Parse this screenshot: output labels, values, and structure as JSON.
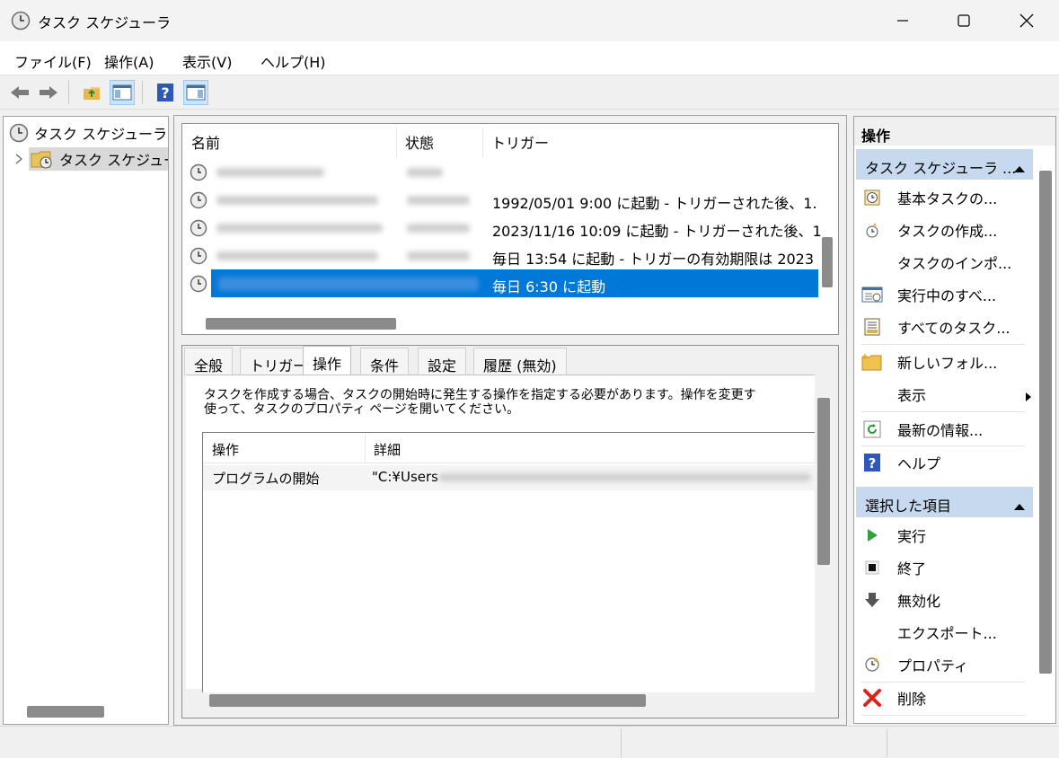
{
  "window": {
    "title": "タスク スケジューラ",
    "icon": "clock-icon",
    "controls": [
      "minimize-icon",
      "maximize-icon",
      "close-icon"
    ]
  },
  "menu": [
    "ファイル(F)",
    "操作(A)",
    "表示(V)",
    "ヘルプ(H)"
  ],
  "toolbar": [
    "back-arrow-icon",
    "forward-arrow-icon",
    "up-folder-icon",
    "show-hide-console-tree-icon",
    "help-icon",
    "show-hide-action-pane-icon"
  ],
  "tree": {
    "root": "タスク スケジューラ (",
    "child": "タスク スケジュー"
  },
  "taskList": {
    "columns": [
      "名前",
      "状態",
      "トリガー"
    ],
    "rows": [
      {
        "trigger": ""
      },
      {
        "trigger": "1992/05/01 9:00 に起動 - トリガーされた後、1."
      },
      {
        "trigger": "2023/11/16 10:09 に起動 - トリガーされた後、1"
      },
      {
        "trigger": "毎日 13:54 に起動 - トリガーの有効期限は 2023"
      },
      {
        "trigger": "毎日 6:30 に起動"
      }
    ]
  },
  "detail": {
    "tabs": [
      "全般",
      "トリガー",
      "操作",
      "条件",
      "設定",
      "履歴 (無効)"
    ],
    "activeTab": 2,
    "description_line1": "タスクを作成する場合、タスクの開始時に発生する操作を指定する必要があります。操作を変更す",
    "description_line2": "使って、タスクのプロパティ ページを開いてください。",
    "grid_columns": [
      "操作",
      "詳細"
    ],
    "grid_row": {
      "action": "プログラムの開始",
      "detail": "\"C:¥Users"
    }
  },
  "actions": {
    "header": "操作",
    "group1": "タスク スケジューラ ...",
    "group1_items": [
      {
        "label": "基本タスクの...",
        "icon": "basic-task-icon"
      },
      {
        "label": "タスクの作成...",
        "icon": "create-task-icon"
      },
      {
        "label": "タスクのインポ...",
        "icon": ""
      },
      {
        "label": "実行中のすべ...",
        "icon": "running-tasks-icon"
      },
      {
        "label": "すべてのタスク...",
        "icon": "all-tasks-history-icon"
      },
      {
        "label": "新しいフォル...",
        "icon": "new-folder-icon"
      },
      {
        "label": "表示",
        "icon": ""
      },
      {
        "label": "最新の情報...",
        "icon": "refresh-icon"
      },
      {
        "label": "ヘルプ",
        "icon": "help-icon"
      }
    ],
    "group2": "選択した項目",
    "group2_items": [
      {
        "label": "実行",
        "icon": "run-icon"
      },
      {
        "label": "終了",
        "icon": "stop-icon"
      },
      {
        "label": "無効化",
        "icon": "disable-icon"
      },
      {
        "label": "エクスポート...",
        "icon": ""
      },
      {
        "label": "プロパティ",
        "icon": "properties-icon"
      },
      {
        "label": "削除",
        "icon": "delete-icon"
      }
    ]
  },
  "colors": {
    "selection": "#0078d7",
    "groupHeader": "#c6d9ee"
  }
}
